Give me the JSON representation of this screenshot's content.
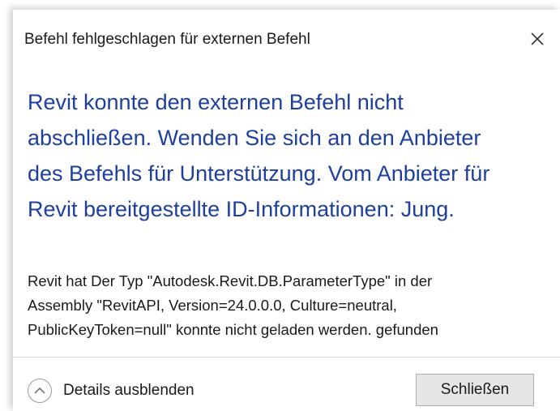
{
  "window": {
    "title": "Befehl fehlgeschlagen für externen Befehl",
    "close_icon": "close-icon"
  },
  "main_instruction": {
    "lines": [
      "Revit konnte den externen Befehl nicht",
      "abschließen. Wenden Sie sich an den Anbieter",
      "des Befehls für Unterstützung. Vom Anbieter für",
      "Revit bereitgestellte ID-Informationen: Jung."
    ]
  },
  "content": {
    "lines": [
      "Revit hat Der Typ \"Autodesk.Revit.DB.ParameterType\" in der",
      "Assembly \"RevitAPI, Version=24.0.0.0, Culture=neutral,",
      "PublicKeyToken=null\" konnte nicht geladen werden. gefunden"
    ]
  },
  "footer": {
    "details_label": "Details ausblenden",
    "details_icon": "chevron-up-icon",
    "close_label": "Schließen"
  },
  "colors": {
    "instruction": "#1f3fa0",
    "text": "#1a1a1a",
    "button_bg": "#e6e6e6",
    "button_border": "#adadad"
  }
}
